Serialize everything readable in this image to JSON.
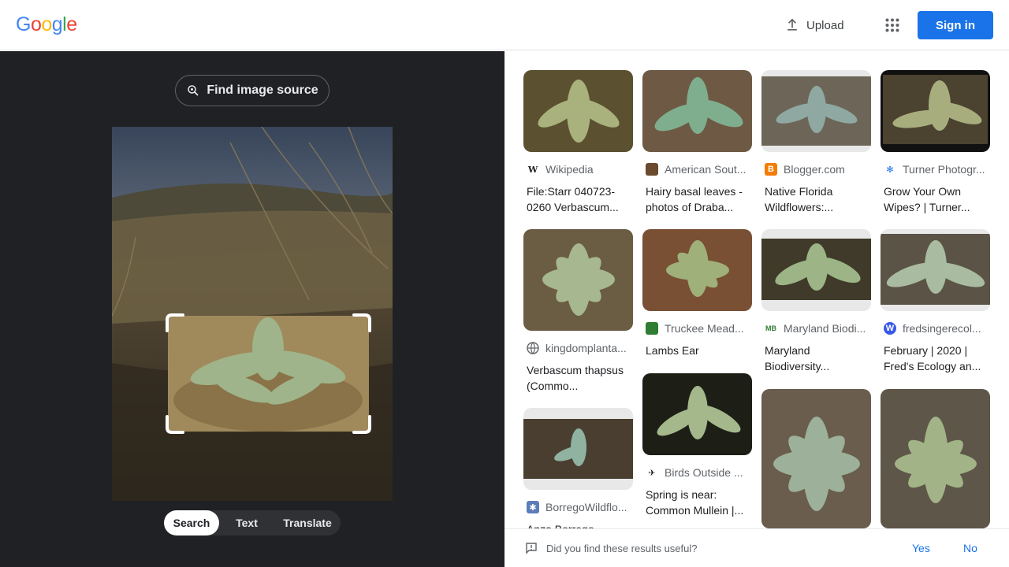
{
  "header": {
    "logo_letters": [
      "G",
      "o",
      "o",
      "g",
      "l",
      "e"
    ],
    "logo_colors": [
      "#4285f4",
      "#ea4335",
      "#fbbc05",
      "#4285f4",
      "#34a853",
      "#ea4335"
    ],
    "upload_label": "Upload",
    "apps_icon": "apps-grid-icon",
    "signin_label": "Sign in"
  },
  "left": {
    "find_source_label": "Find image source",
    "tabs": [
      {
        "label": "Search",
        "active": true
      },
      {
        "label": "Text",
        "active": false
      },
      {
        "label": "Translate",
        "active": false
      }
    ]
  },
  "results": [
    {
      "source": "Wikipedia",
      "icon": "wikipedia-icon",
      "title": "File:Starr 040723-0260 Verbascum..."
    },
    {
      "source": "American Sout...",
      "icon": "site-icon",
      "title": "Hairy basal leaves - photos of Draba..."
    },
    {
      "source": "Blogger.com",
      "icon": "blogger-icon",
      "title": "Native Florida Wildflowers:..."
    },
    {
      "source": "Turner Photogr...",
      "icon": "site-icon",
      "title": "Grow Your Own Wipes? | Turner..."
    },
    {
      "source": "kingdomplanta...",
      "icon": "globe-icon",
      "title": "Verbascum thapsus (Commo..."
    },
    {
      "source": "Truckee Mead...",
      "icon": "site-icon",
      "title": "Lambs Ear"
    },
    {
      "source": "Maryland Biodi...",
      "icon": "site-icon",
      "title": "Maryland Biodiversity..."
    },
    {
      "source": "fredsingerecol...",
      "icon": "wordpress-icon",
      "title": "February | 2020 | Fred's Ecology an..."
    },
    {
      "source": "BorregoWildflo...",
      "icon": "site-icon",
      "title": "Anza Borrego..."
    },
    {
      "source": "Birds Outside ...",
      "icon": "site-icon",
      "title": "Spring is near: Common Mullein |..."
    }
  ],
  "feedback": {
    "question": "Did you find these results useful?",
    "yes": "Yes",
    "no": "No"
  }
}
